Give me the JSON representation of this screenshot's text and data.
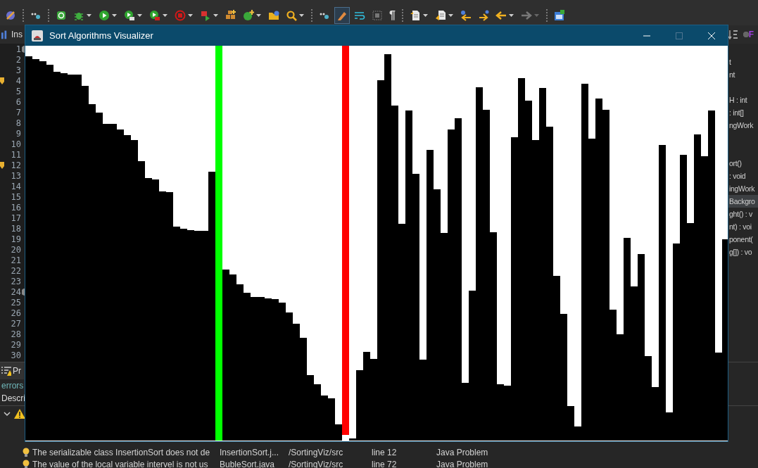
{
  "toolbar": {
    "glyph_button": "¶",
    "pencil_toggle": {
      "on": true
    }
  },
  "editor_tab": {
    "label": "Ins"
  },
  "editor": {
    "lines": [
      {
        "number": "1",
        "warning": false,
        "fold": true
      },
      {
        "number": "2",
        "warning": false,
        "fold": false
      },
      {
        "number": "3",
        "warning": false,
        "fold": false
      },
      {
        "number": "4",
        "warning": true,
        "fold": false
      },
      {
        "number": "5",
        "warning": false,
        "fold": false
      },
      {
        "number": "6",
        "warning": false,
        "fold": false
      },
      {
        "number": "7",
        "warning": false,
        "fold": false
      },
      {
        "number": "8",
        "warning": false,
        "fold": false
      },
      {
        "number": "9",
        "warning": false,
        "fold": false
      },
      {
        "number": "10",
        "warning": false,
        "fold": false
      },
      {
        "number": "11",
        "warning": false,
        "fold": false
      },
      {
        "number": "12",
        "warning": true,
        "fold": false
      },
      {
        "number": "13",
        "warning": false,
        "fold": false
      },
      {
        "number": "14",
        "warning": false,
        "fold": false
      },
      {
        "number": "15",
        "warning": false,
        "fold": false
      },
      {
        "number": "16",
        "warning": false,
        "fold": false
      },
      {
        "number": "17",
        "warning": false,
        "fold": false
      },
      {
        "number": "18",
        "warning": false,
        "fold": false
      },
      {
        "number": "19",
        "warning": false,
        "fold": false
      },
      {
        "number": "20",
        "warning": false,
        "fold": false
      },
      {
        "number": "21",
        "warning": false,
        "fold": false
      },
      {
        "number": "22",
        "warning": false,
        "fold": false
      },
      {
        "number": "23",
        "warning": false,
        "fold": false
      },
      {
        "number": "24",
        "warning": false,
        "fold": true
      },
      {
        "number": "25",
        "warning": false,
        "fold": false
      },
      {
        "number": "26",
        "warning": false,
        "fold": false
      },
      {
        "number": "27",
        "warning": false,
        "fold": false
      },
      {
        "number": "28",
        "warning": false,
        "fold": false
      },
      {
        "number": "29",
        "warning": false,
        "fold": false
      },
      {
        "number": "30",
        "warning": false,
        "fold": false
      }
    ]
  },
  "outline": {
    "filter_letter": "F",
    "items": [
      {
        "label": "t",
        "selected": false
      },
      {
        "label": "nt",
        "selected": false
      },
      {
        "label": "H : int",
        "selected": false
      },
      {
        "label": ": int[]",
        "selected": false
      },
      {
        "label": "ngWork",
        "selected": false
      },
      {
        "label": "ort()",
        "selected": false
      },
      {
        "label": ": void",
        "selected": false
      },
      {
        "label": "ingWork",
        "selected": false
      },
      {
        "label": "Backgro",
        "selected": true
      },
      {
        "label": "ght() : v",
        "selected": false
      },
      {
        "label": "nt) : voi",
        "selected": false
      },
      {
        "label": "ponent(",
        "selected": false
      },
      {
        "label": "g[]) : vo",
        "selected": false
      }
    ]
  },
  "problems": {
    "tab_label": "Pr",
    "summary": "errors",
    "header": "Descri",
    "group": {
      "expanded": true
    },
    "rows": [
      {
        "description": "The serializable class InsertionSort does not de",
        "resource": "InsertionSort.j...",
        "path": "/SortingViz/src",
        "location": "line 12",
        "type": "Java Problem"
      },
      {
        "description": "The value of the local variable intervel is not us",
        "resource": "BubleSort.java",
        "path": "/SortingViz/src",
        "location": "line 72",
        "type": "Java Problem"
      }
    ]
  },
  "window": {
    "title": "Sort Algorithms Visualizer",
    "maximize_disabled": true
  }
}
